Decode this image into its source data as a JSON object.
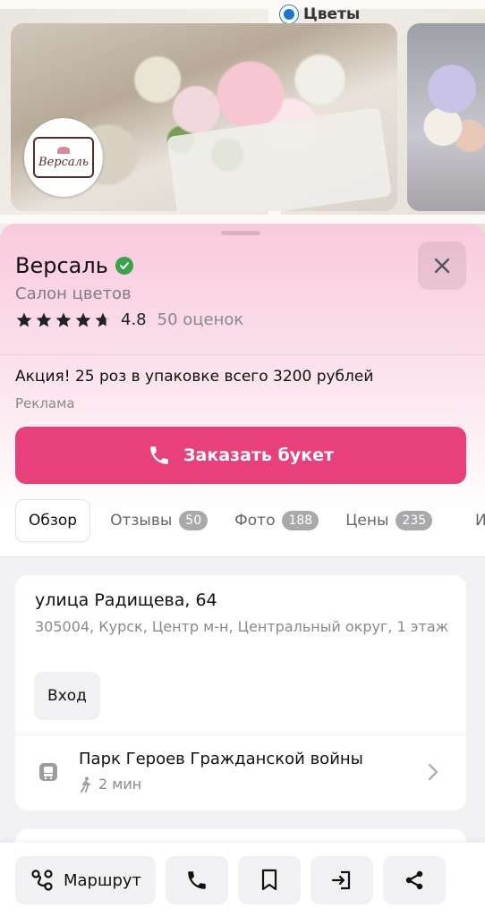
{
  "map": {
    "pin_label": "Цветы",
    "icons": [
      "location-pin-icon"
    ]
  },
  "business": {
    "logo_text": "Версаль",
    "name": "Версаль",
    "category": "Салон цветов",
    "rating": "4.8",
    "rating_stars": 4.8,
    "rating_count": "50 оценок",
    "promo_text": "Акция! 25 роз в упаковке всего 3200 рублей",
    "ad_label": "Реклама"
  },
  "cta": {
    "label": "Заказать букет",
    "icon": "phone-icon",
    "color": "#e8407b"
  },
  "tabs": [
    {
      "label": "Обзор",
      "badge": ""
    },
    {
      "label": "Отзывы",
      "badge": "50"
    },
    {
      "label": "Фото",
      "badge": "188"
    },
    {
      "label": "Цены",
      "badge": "235"
    },
    {
      "label": "И",
      "badge": ""
    }
  ],
  "address": {
    "street": "улица Радищева, 64",
    "full": "305004, Курск, Центр м-н, Центральный округ, 1 этаж",
    "entrance_label": "Вход"
  },
  "transit": {
    "stop_name": "Парк Героев Гражданской войны",
    "walk_time": "2 мин",
    "icons": [
      "bus-stop-icon",
      "walking-icon",
      "chevron-right-icon"
    ]
  },
  "bottom_bar": {
    "route_label": "Маршрут",
    "icons": [
      "route-icon",
      "phone-icon",
      "bookmark-icon",
      "login-icon",
      "share-icon"
    ]
  },
  "colors": {
    "accent": "#e8407b",
    "verified": "#3aa34a",
    "badge": "#a9a9ac"
  }
}
